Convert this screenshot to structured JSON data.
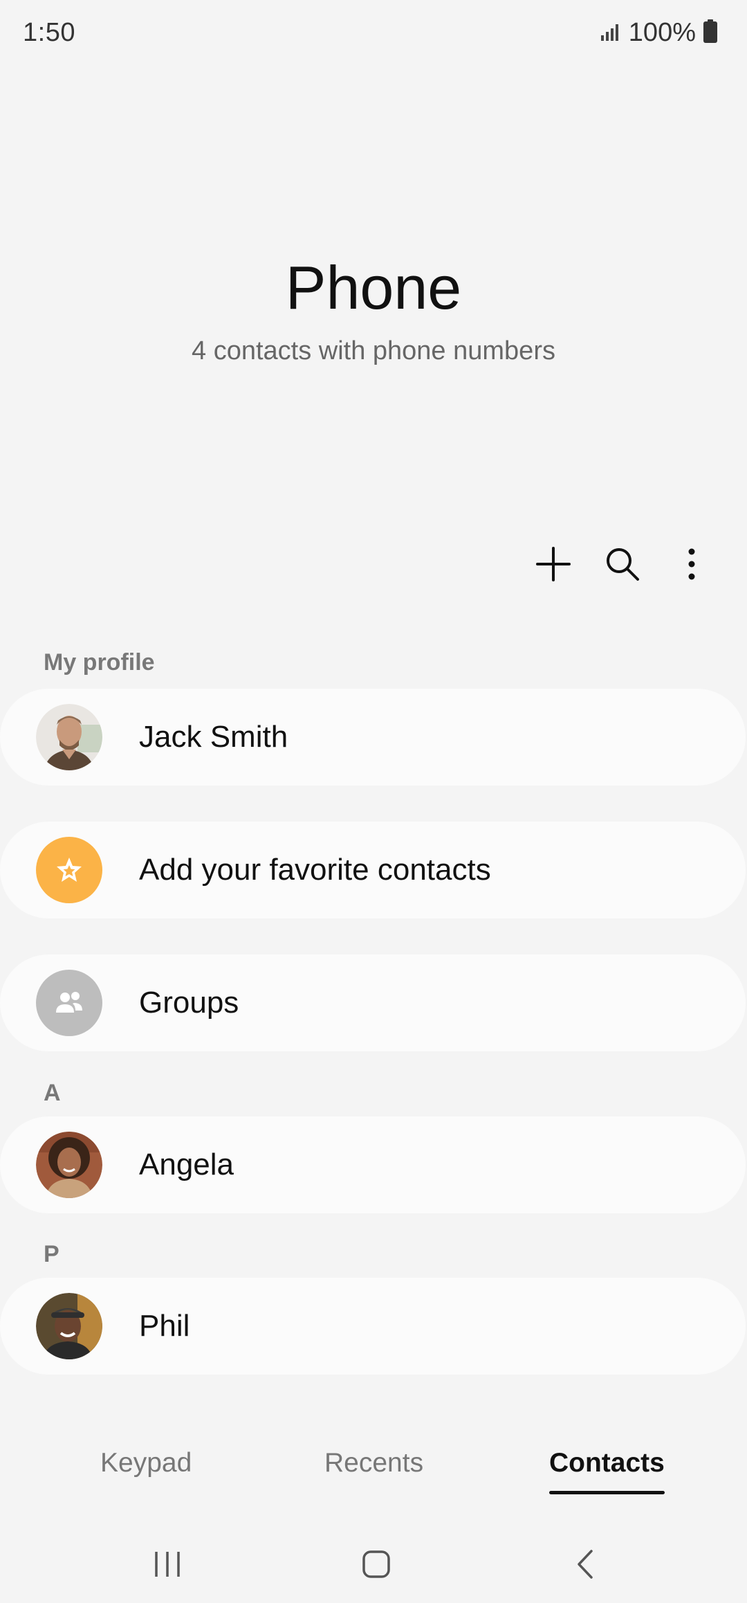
{
  "status_bar": {
    "time": "1:50",
    "battery": "100%"
  },
  "header": {
    "title": "Phone",
    "subtitle": "4 contacts with phone numbers"
  },
  "toolbar": {
    "add_icon": "plus-icon",
    "search_icon": "search-icon",
    "more_icon": "more-vertical-icon"
  },
  "sections": {
    "my_profile_label": "My profile",
    "section_a_label": "A",
    "section_p_label": "P"
  },
  "rows": {
    "profile_name": "Jack Smith",
    "favorites_label": "Add your favorite contacts",
    "groups_label": "Groups",
    "contact_angela": "Angela",
    "contact_phil": "Phil"
  },
  "tabs": {
    "keypad": "Keypad",
    "recents": "Recents",
    "contacts": "Contacts",
    "active": "contacts"
  },
  "colors": {
    "favorites_accent": "#fbb347",
    "groups_avatar": "#bdbdbd",
    "background": "#f4f4f4",
    "row_background": "#fbfbfb"
  }
}
